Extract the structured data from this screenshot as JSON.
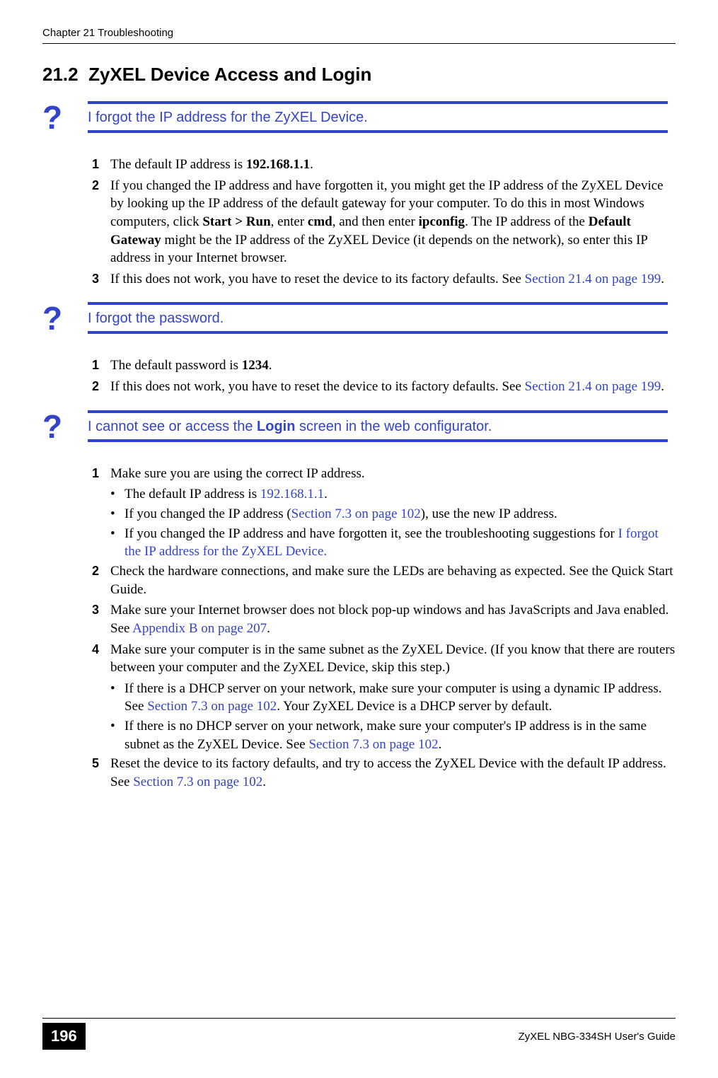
{
  "header": {
    "chapter": "Chapter 21 Troubleshooting"
  },
  "section": {
    "number": "21.2",
    "title": "ZyXEL Device Access and Login"
  },
  "q1": {
    "mark": "?",
    "text": "I forgot the IP address for the ZyXEL Device.",
    "a1_num": "1",
    "a1_pre": "The default IP address is ",
    "a1_ip": "192.168.1.1",
    "a1_post": ".",
    "a2_num": "2",
    "a2_p1": "If you changed the IP address and have forgotten it, you might get the IP address of the ZyXEL Device by looking up the IP address of the default gateway for your computer. To do this in most Windows computers, click ",
    "a2_b1": "Start > Run",
    "a2_p2": ", enter ",
    "a2_b2": "cmd",
    "a2_p3": ", and then enter ",
    "a2_b3": "ipconfig",
    "a2_p4": ". The IP address of the ",
    "a2_b4": "Default Gateway",
    "a2_p5": " might be the IP address of the ZyXEL Device (it depends on the network), so enter this IP address in your Internet browser.",
    "a3_num": "3",
    "a3_p1": "If this does not work, you have to reset the device to its factory defaults. See ",
    "a3_link": "Section 21.4 on page 199",
    "a3_p2": "."
  },
  "q2": {
    "mark": "?",
    "text": "I forgot the password.",
    "a1_num": "1",
    "a1_pre": "The default password is ",
    "a1_pw": "1234",
    "a1_post": ".",
    "a2_num": "2",
    "a2_p1": "If this does not work, you have to reset the device to its factory defaults. See ",
    "a2_link": "Section 21.4 on page 199",
    "a2_p2": "."
  },
  "q3": {
    "mark": "?",
    "text_pre": "I cannot see or access the ",
    "text_bold": "Login",
    "text_post": " screen in the web configurator.",
    "a1_num": "1",
    "a1_text": "Make sure you are using the correct IP address.",
    "a1_b1_pre": "The default IP address is ",
    "a1_b1_link": "192.168.1.1",
    "a1_b1_post": ".",
    "a1_b2_pre": "If you changed the IP address (",
    "a1_b2_link": "Section 7.3 on page 102",
    "a1_b2_post": "), use the new IP address.",
    "a1_b3_pre": "If you changed the IP address and have forgotten it, see the troubleshooting suggestions for ",
    "a1_b3_link": "I forgot the IP address for the ZyXEL Device.",
    "a2_num": "2",
    "a2_text": "Check the hardware connections, and make sure the LEDs are behaving as expected. See the Quick Start Guide.",
    "a3_num": "3",
    "a3_pre": "Make sure your Internet browser does not block pop-up windows and has JavaScripts and Java enabled. See ",
    "a3_link": "Appendix B on page 207",
    "a3_post": ".",
    "a4_num": "4",
    "a4_text": "Make sure your computer is in the same subnet as the ZyXEL Device. (If you know that there are routers between your computer and the ZyXEL Device, skip this step.)",
    "a4_b1_pre": "If there is a DHCP server on your network, make sure your computer is using a dynamic IP address. See ",
    "a4_b1_link": "Section 7.3 on page 102",
    "a4_b1_post": ". Your ZyXEL Device is a DHCP server by default.",
    "a4_b2_pre": "If there is no DHCP server on your network, make sure your computer's IP address is in the same subnet as the ZyXEL Device. See ",
    "a4_b2_link": "Section 7.3 on page 102",
    "a4_b2_post": ".",
    "a5_num": "5",
    "a5_pre": "Reset the device to its factory defaults, and try to access the ZyXEL Device with the default IP address. See ",
    "a5_link": "Section 7.3 on page 102",
    "a5_post": "."
  },
  "footer": {
    "page": "196",
    "guide": "ZyXEL NBG-334SH User's Guide"
  },
  "bullet": "•"
}
